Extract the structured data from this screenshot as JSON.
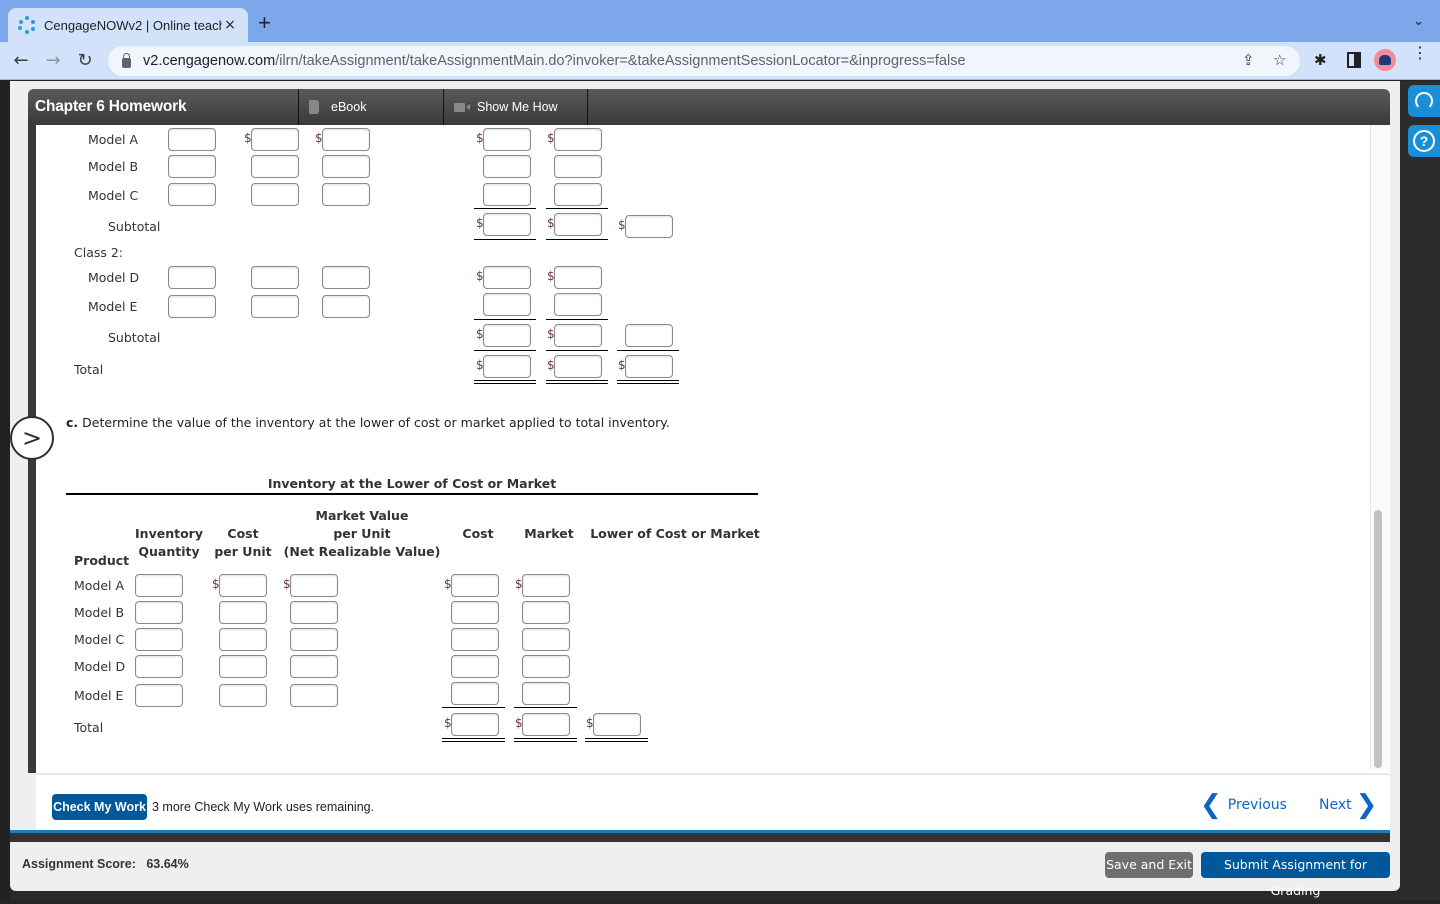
{
  "browser": {
    "tab_title": "CengageNOWv2 | Online teach",
    "close_glyph": "×",
    "newtab_glyph": "+",
    "dropdown_glyph": "⌄",
    "url_host": "v2.cengagenow.com",
    "url_path": "/ilrn/takeAssignment/takeAssignmentMain.do?invoker=&takeAssignmentSessionLocator=&inprogress=false",
    "back_glyph": "←",
    "forward_glyph": "→",
    "reload_glyph": "↻",
    "share_glyph": "⇪",
    "star_glyph": "☆",
    "ext_glyph": "✱",
    "menu_glyph": "⋮"
  },
  "header": {
    "title": "Chapter 6 Homework",
    "ebook": "eBook",
    "show_me_how": "Show Me How"
  },
  "part_b": {
    "class1_rows": [
      "Model A",
      "Model B",
      "Model C"
    ],
    "subtotal1": "Subtotal",
    "class2_label": "Class 2:",
    "class2_rows": [
      "Model D",
      "Model E"
    ],
    "subtotal2": "Subtotal",
    "total": "Total"
  },
  "part_c": {
    "instruction_letter": "c.",
    "instruction": "Determine the value of the inventory at the lower of cost or market applied to total inventory.",
    "table_title": "Inventory at the Lower of Cost or Market",
    "columns": {
      "product": "Product",
      "inv_qty_1": "Inventory",
      "inv_qty_2": "Quantity",
      "cost_pu_1": "Cost",
      "cost_pu_2": "per Unit",
      "mv_1": "Market Value",
      "mv_2": "per Unit",
      "mv_3": "(Net Realizable Value)",
      "cost": "Cost",
      "market": "Market",
      "lcm": "Lower of Cost or Market"
    },
    "rows": [
      "Model A",
      "Model B",
      "Model C",
      "Model D",
      "Model E"
    ],
    "total": "Total"
  },
  "currency_symbol": "$",
  "expand_glyph": ">",
  "footer": {
    "check_my_work": "Check My Work",
    "check_note": "3 more Check My Work uses remaining.",
    "previous": "Previous",
    "next": "Next",
    "prev_glyph": "❮",
    "next_glyph": "❯",
    "score_label": "Assignment Score:",
    "score_value": "63.64%",
    "save_exit": "Save and Exit",
    "submit": "Submit Assignment for Grading"
  },
  "help": {
    "help_glyph": "?"
  }
}
